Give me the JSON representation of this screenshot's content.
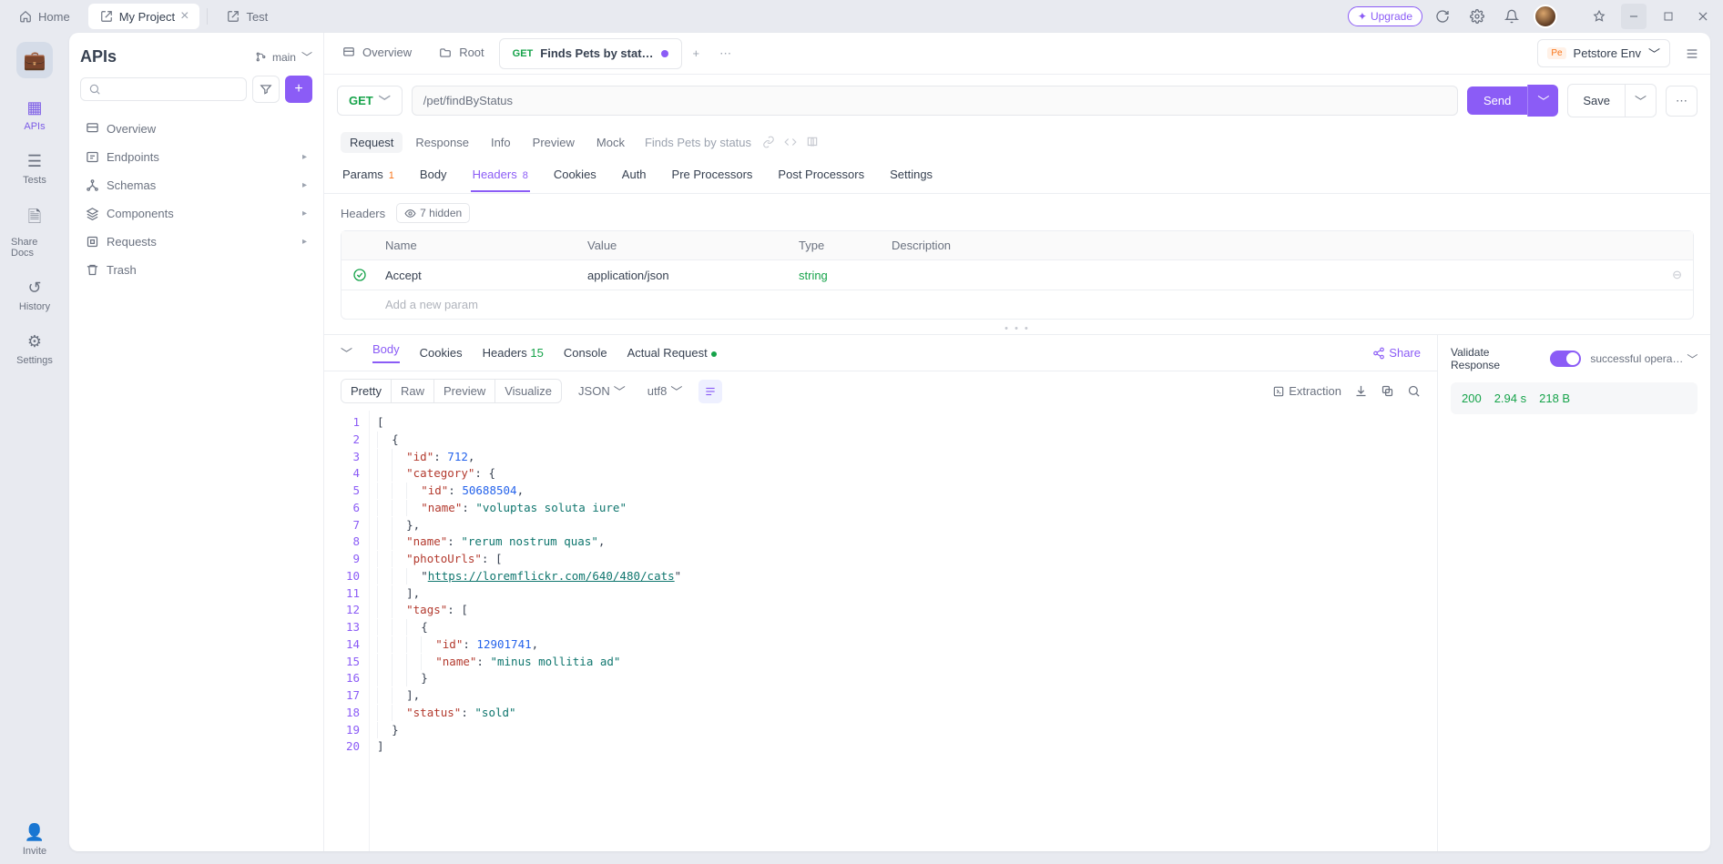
{
  "title_tabs": [
    {
      "label": "Home",
      "icon": "home",
      "active": false
    },
    {
      "label": "My Project",
      "icon": "open-in-new",
      "active": true,
      "closable": true
    },
    {
      "label": "Test",
      "icon": "open-in-new",
      "active": false
    }
  ],
  "upgrade_label": "Upgrade",
  "rail": {
    "items": [
      {
        "label": "APIs",
        "active": true
      },
      {
        "label": "Tests",
        "active": false
      },
      {
        "label": "Share Docs",
        "active": false
      },
      {
        "label": "History",
        "active": false
      },
      {
        "label": "Settings",
        "active": false
      }
    ],
    "invite": "Invite"
  },
  "sidebar": {
    "title": "APIs",
    "branch": "main",
    "search_placeholder": "",
    "items": [
      {
        "label": "Overview",
        "expandable": false
      },
      {
        "label": "Endpoints",
        "expandable": true
      },
      {
        "label": "Schemas",
        "expandable": true
      },
      {
        "label": "Components",
        "expandable": true
      },
      {
        "label": "Requests",
        "expandable": true
      },
      {
        "label": "Trash",
        "expandable": false
      }
    ]
  },
  "editor_tabs": [
    {
      "kind": "overview",
      "label": "Overview"
    },
    {
      "kind": "folder",
      "label": "Root"
    },
    {
      "kind": "request",
      "method": "GET",
      "label": "Finds Pets by stat…",
      "dirty": true,
      "current": true
    }
  ],
  "env": {
    "badge": "Pe",
    "name": "Petstore Env"
  },
  "request": {
    "method": "GET",
    "url": "/pet/findByStatus",
    "send": "Send",
    "save": "Save"
  },
  "subtabs": {
    "items": [
      "Request",
      "Response",
      "Info",
      "Preview",
      "Mock"
    ],
    "active": "Request",
    "breadcrumb": "Finds Pets by status"
  },
  "reqtabs": [
    {
      "label": "Params",
      "badge": "1",
      "badge_style": "orange"
    },
    {
      "label": "Body"
    },
    {
      "label": "Headers",
      "badge": "8",
      "badge_style": "purple",
      "active": true
    },
    {
      "label": "Cookies"
    },
    {
      "label": "Auth"
    },
    {
      "label": "Pre Processors"
    },
    {
      "label": "Post Processors"
    },
    {
      "label": "Settings"
    }
  ],
  "headers_table": {
    "title": "Headers",
    "hidden_pill": "7 hidden",
    "columns": [
      "Name",
      "Value",
      "Type",
      "Description"
    ],
    "rows": [
      {
        "checked": true,
        "name": "Accept",
        "value": "application/json",
        "type": "string",
        "desc": ""
      }
    ],
    "add_placeholder": "Add a new param"
  },
  "resp_tabs": [
    {
      "label": "Body",
      "active": true
    },
    {
      "label": "Cookies"
    },
    {
      "label": "Headers",
      "badge": "15"
    },
    {
      "label": "Console"
    },
    {
      "label": "Actual Request",
      "dot": true
    }
  ],
  "share_label": "Share",
  "resp_tools": {
    "views": [
      "Pretty",
      "Raw",
      "Preview",
      "Visualize"
    ],
    "active_view": "Pretty",
    "format": "JSON",
    "encoding": "utf8",
    "extraction": "Extraction"
  },
  "response_body_lines": [
    "[",
    "  {",
    "    \"id\": 712,",
    "    \"category\": {",
    "      \"id\": 50688504,",
    "      \"name\": \"voluptas soluta iure\"",
    "    },",
    "    \"name\": \"rerum nostrum quas\",",
    "    \"photoUrls\": [",
    "      \"https://loremflickr.com/640/480/cats\"",
    "    ],",
    "    \"tags\": [",
    "      {",
    "        \"id\": 12901741,",
    "        \"name\": \"minus mollitia ad\"",
    "      }",
    "    ],",
    "    \"status\": \"sold\"",
    "  }",
    "]"
  ],
  "validate": {
    "label": "Validate Response",
    "schema": "successful opera…"
  },
  "status": {
    "code": "200",
    "time": "2.94 s",
    "size": "218 B"
  }
}
